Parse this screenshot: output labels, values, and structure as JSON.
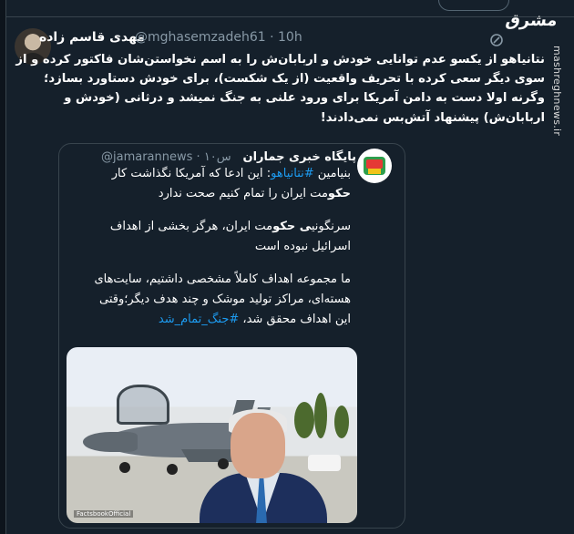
{
  "watermark": {
    "logo_text": "مشرق",
    "url": "mashreghnews.ir"
  },
  "tweet": {
    "display_name": "مهدی قاسم زاده",
    "handle": "@mghasemzadeh61",
    "time": "10h",
    "text_lines": [
      "نتانیاهو از یکسو عدم توانایی خودش و اربابان‌ش را به اسم نخواستن‌شان فاکتور کرده و از",
      "سوی دیگر سعی کرده با تحریف واقعیت (از یک شکست)، برای خودش دستاورد بسازد؛",
      "وگرنه اولا دست به دامن آمریکا برای ورود علنی به جنگ نمیشد و درثانی (خودش و",
      "اربابان‌ش) پیشنهاد آتش‌بس نمی‌دادند!"
    ]
  },
  "quote": {
    "display_name": "پایگاه خبری جماران",
    "handle": "@jamarannews",
    "time": "۱۰س",
    "line1_prefix": "بنیامین",
    "line1_hashtag": "#نتانیاهو",
    "line1_suffix": ": این ادعا که آمریکا نگذاشت کار",
    "line2_bold": "حکو",
    "line2_rest": "مت ایران را تمام کنیم صحت ندارد",
    "line3_prefix": "سرنگونی",
    "line3_bold": "ی حکو",
    "line3_rest": "مت ایران، هرگز بخشی از اهداف",
    "line4": "اسرائیل نبوده است",
    "line5": "ما مجموعه اهداف کاملاً مشخصی داشتیم، سایت‌های",
    "line6": "هسته‌ای، مراکز تولید موشک و چند هدف دیگر؛وقتی",
    "line7_prefix": "این اهداف محقق شد، ",
    "line7_hashtag": "#جنگ_تمام_شد",
    "image_credit": "FactsbookOfficial"
  },
  "colors": {
    "background": "#15202b",
    "border": "#38444d",
    "muted": "#8899a6",
    "link": "#1d9bf0"
  },
  "icons": {
    "more": "more-options-icon"
  }
}
